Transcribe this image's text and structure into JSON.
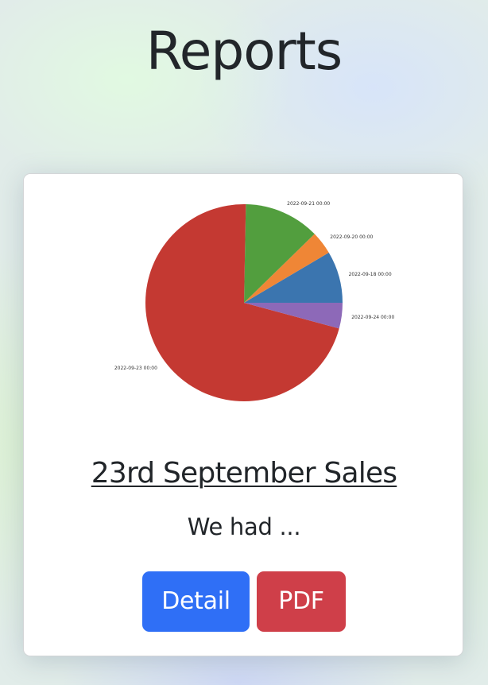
{
  "page": {
    "title": "Reports"
  },
  "report": {
    "title": "23rd September Sales",
    "summary": "We had ...",
    "buttons": {
      "detail": "Detail",
      "pdf": "PDF"
    }
  },
  "colors": {
    "detail_button": "#2f6ff6",
    "pdf_button": "#cf3f49"
  },
  "chart_data": {
    "type": "pie",
    "slices": [
      {
        "label": "2022-09-18 00:00",
        "value": 8.5,
        "color": "#3b75af"
      },
      {
        "label": "2022-09-20 00:00",
        "value": 3.8,
        "color": "#ef8636"
      },
      {
        "label": "2022-09-21 00:00",
        "value": 12.4,
        "color": "#529e3e"
      },
      {
        "label": "2022-09-23 00:00",
        "value": 71.1,
        "color": "#c43932"
      },
      {
        "label": "2022-09-24 00:00",
        "value": 4.2,
        "color": "#8d69b8"
      }
    ]
  }
}
